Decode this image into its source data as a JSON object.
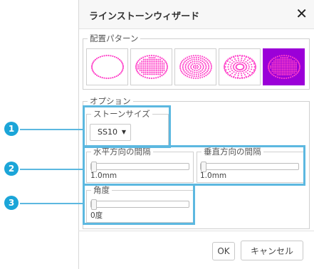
{
  "dialog": {
    "title": "ラインストーンウィザード",
    "close_symbol": "✕"
  },
  "pattern": {
    "legend": "配置パターン",
    "options": [
      {
        "name": "outline-oval",
        "selected": false
      },
      {
        "name": "filled-oval",
        "selected": false
      },
      {
        "name": "ring-pattern-oval",
        "selected": false
      },
      {
        "name": "radial-pattern-oval",
        "selected": false
      },
      {
        "name": "grid-fill-oval",
        "selected": true
      }
    ],
    "dot_color": "#ff40c8",
    "selected_color": "#9b00d8"
  },
  "options": {
    "legend": "オプション",
    "stone_size": {
      "legend": "ストーンサイズ",
      "value": "SS10"
    },
    "horizontal_spacing": {
      "legend": "水平方向の間隔",
      "value": "1.0mm"
    },
    "vertical_spacing": {
      "legend": "垂直方向の間隔",
      "value": "1.0mm"
    },
    "angle": {
      "legend": "角度",
      "value": "0度"
    }
  },
  "callouts": {
    "badge1": "1",
    "badge2": "2",
    "badge3": "3",
    "color": "#5cb8e0",
    "badge_color": "#1ba5d8"
  },
  "buttons": {
    "ok": "OK",
    "cancel": "キャンセル"
  }
}
